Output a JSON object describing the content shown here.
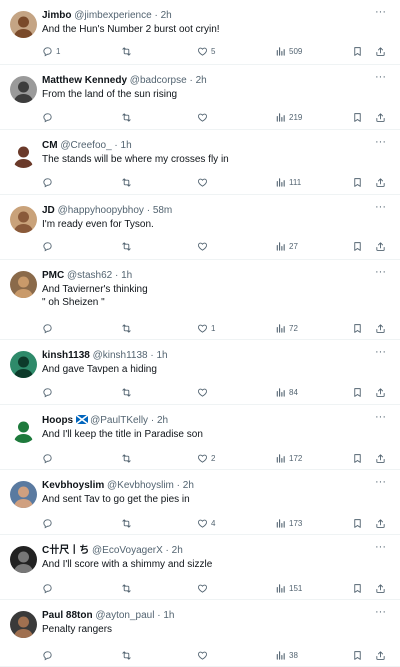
{
  "tweets": [
    {
      "name": "Jimbo",
      "handle": "@jimbexperience",
      "dot": "·",
      "time": "2h",
      "lines": [
        "And the Hun's Number 2 burst oot cryin!"
      ],
      "replies": "1",
      "retweets": "",
      "likes": "5",
      "views": "509",
      "more": "···"
    },
    {
      "name": "Matthew Kennedy",
      "handle": "@badcorpse",
      "dot": "·",
      "time": "2h",
      "lines": [
        "From the land of the sun rising"
      ],
      "replies": "",
      "retweets": "",
      "likes": "",
      "views": "219",
      "more": "···"
    },
    {
      "name": "CM",
      "handle": "@Creefoo_",
      "dot": "·",
      "time": "1h",
      "lines": [
        "The stands will be where my crosses fly in"
      ],
      "replies": "",
      "retweets": "",
      "likes": "",
      "views": "111",
      "more": "···"
    },
    {
      "name": "JD",
      "handle": "@happyhoopybhoy",
      "dot": "·",
      "time": "58m",
      "lines": [
        "I'm ready even for Tyson."
      ],
      "replies": "",
      "retweets": "",
      "likes": "",
      "views": "27",
      "more": "···"
    },
    {
      "name": "PMC",
      "handle": "@stash62",
      "dot": "·",
      "time": "1h",
      "lines": [
        "And Tavierner's thinking",
        "\" oh Sheizen \""
      ],
      "replies": "",
      "retweets": "",
      "likes": "1",
      "views": "72",
      "more": "···"
    },
    {
      "name": "kinsh1138",
      "handle": "@kinsh1138",
      "dot": "·",
      "time": "1h",
      "lines": [
        "And gave Tavpen a hiding"
      ],
      "replies": "",
      "retweets": "",
      "likes": "",
      "views": "84",
      "more": "···"
    },
    {
      "name": "Hoops",
      "handle": "@PaulTKelly",
      "dot": "·",
      "time": "2h",
      "flag": "scotland-flag-icon",
      "lines": [
        "And I'll keep the title in Paradise son"
      ],
      "replies": "",
      "retweets": "",
      "likes": "2",
      "views": "172",
      "more": "···"
    },
    {
      "name": "Kevbhoyslim",
      "handle": "@Kevbhoyslim",
      "dot": "·",
      "time": "2h",
      "lines": [
        "And sent Tav to go get the pies in"
      ],
      "replies": "",
      "retweets": "",
      "likes": "4",
      "views": "173",
      "more": "···"
    },
    {
      "name": "C卄尺丨ち",
      "handle": "@EcoVoyagerX",
      "dot": "·",
      "time": "2h",
      "lines": [
        "And I'll score with a shimmy and sizzle"
      ],
      "replies": "",
      "retweets": "",
      "likes": "",
      "views": "151",
      "more": "···"
    },
    {
      "name": "Paul 88ton",
      "handle": "@ayton_paul",
      "dot": "·",
      "time": "1h",
      "lines": [
        "Penalty rangers"
      ],
      "replies": "",
      "retweets": "",
      "likes": "",
      "views": "38",
      "more": "···"
    }
  ],
  "colors": {
    "text": "#0f1419",
    "muted": "#536471",
    "divider": "#eff3f4"
  }
}
